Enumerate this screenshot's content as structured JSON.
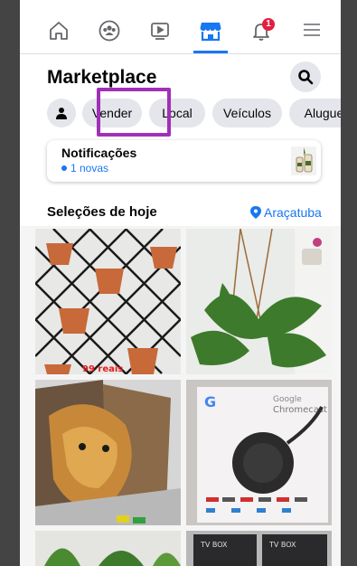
{
  "nav": {
    "items": [
      {
        "name": "home",
        "icon": "home-icon"
      },
      {
        "name": "groups",
        "icon": "groups-icon"
      },
      {
        "name": "watch",
        "icon": "video-play-icon"
      },
      {
        "name": "marketplace",
        "icon": "marketplace-shop-icon",
        "active": true
      },
      {
        "name": "notifications",
        "icon": "bell-icon",
        "badge": "1"
      },
      {
        "name": "menu",
        "icon": "hamburger-menu-icon"
      }
    ]
  },
  "header": {
    "title": "Marketplace"
  },
  "chips": [
    "Vender",
    "Local",
    "Veículos",
    "Aluguel"
  ],
  "notifications": {
    "title": "Notificações",
    "subtitle": "1 novas"
  },
  "section": {
    "title": "Seleções de hoje",
    "location": "Araçatuba"
  },
  "listings": [
    {
      "name": "listing-wall-planters",
      "overlay_text": "99 reais"
    },
    {
      "name": "listing-hanging-fern"
    },
    {
      "name": "listing-lion-art-panels"
    },
    {
      "name": "listing-google-chromecast",
      "brand_text": "Google",
      "product_text": "Chromecast"
    },
    {
      "name": "listing-plants-bottom"
    },
    {
      "name": "listing-tv-box",
      "brand_text": "TV BOX"
    }
  ],
  "colors": {
    "accent": "#1877f2",
    "highlight": "#a12fb8",
    "badge": "#e41e3f"
  }
}
